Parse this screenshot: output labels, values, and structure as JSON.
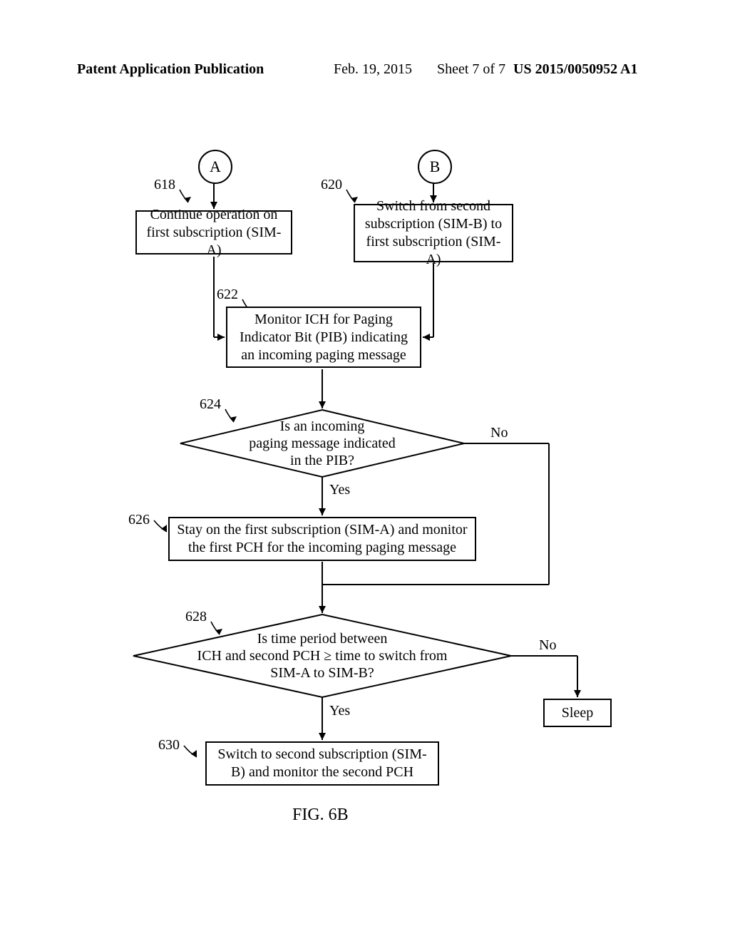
{
  "header": {
    "left": "Patent Application Publication",
    "date": "Feb. 19, 2015",
    "sheet": "Sheet 7 of 7",
    "pubno": "US 2015/0050952 A1"
  },
  "connectors": {
    "A": "A",
    "B": "B"
  },
  "refs": {
    "r618": "618",
    "r620": "620",
    "r622": "622",
    "r624": "624",
    "r626": "626",
    "r628": "628",
    "r630": "630"
  },
  "boxes": {
    "b618": "Continue operation on first subscription (SIM-A)",
    "b620": "Switch from second subscription (SIM-B) to first subscription (SIM-A)",
    "b622": "Monitor ICH for Paging Indicator Bit (PIB) indicating an incoming paging message",
    "b626": "Stay on the first subscription (SIM-A) and monitor the first PCH for the incoming paging message",
    "b630": "Switch to second subscription (SIM-B) and monitor the second PCH",
    "sleep": "Sleep"
  },
  "decisions": {
    "d624": "Is an incoming\npaging message indicated\nin the PIB?",
    "d628": "Is time period between\nICH and second PCH ≥ time to switch from\nSIM-A to SIM-B?"
  },
  "branches": {
    "yes": "Yes",
    "no": "No"
  },
  "caption": "FIG. 6B"
}
